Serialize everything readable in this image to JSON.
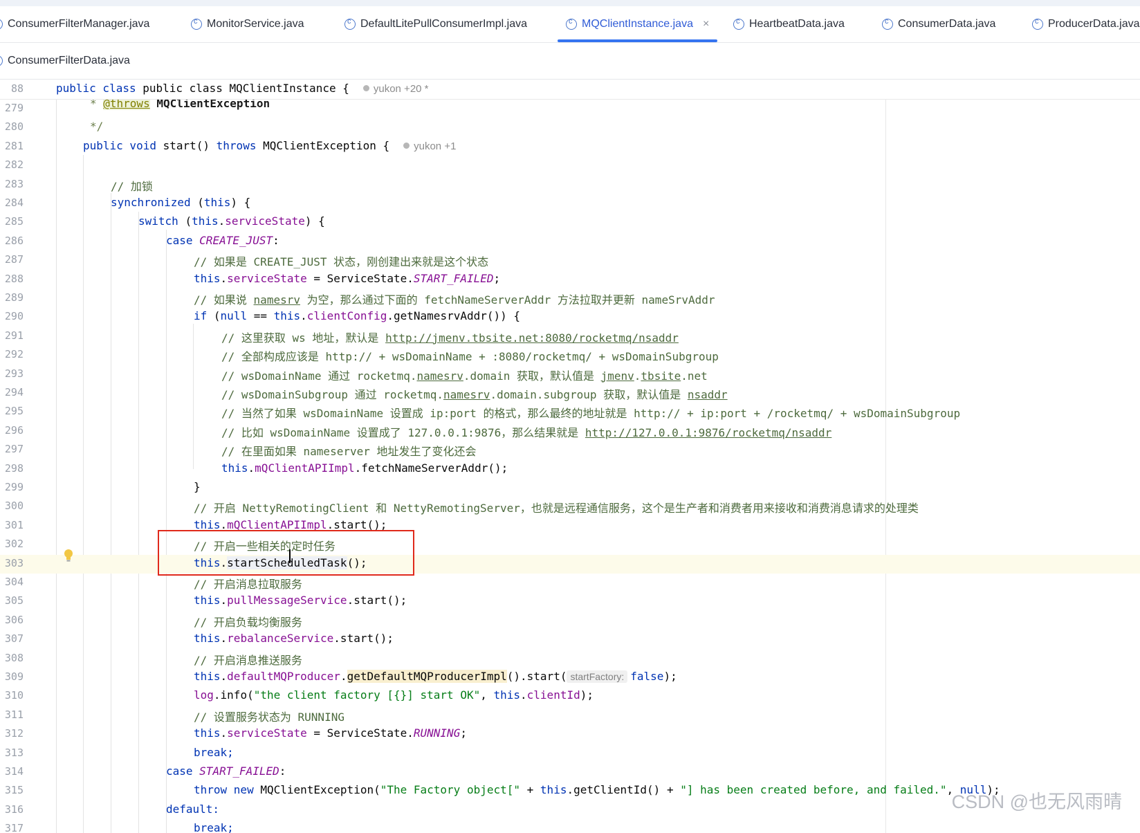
{
  "tabs": {
    "row1": [
      {
        "label": "ConsumerFilterManager.java"
      },
      {
        "label": "MonitorService.java"
      },
      {
        "label": "DefaultLitePullConsumerImpl.java"
      },
      {
        "label": "MQClientInstance.java",
        "close": "×"
      },
      {
        "label": "HeartbeatData.java"
      },
      {
        "label": "ConsumerData.java"
      },
      {
        "label": "ProducerData.java"
      }
    ],
    "row2": [
      {
        "label": "ConsumerFilterData.java"
      }
    ]
  },
  "sticky_header": {
    "line_number": "88",
    "code": "public class MQClientInstance {",
    "author": "yukon +20 *"
  },
  "method_author": "yukon +1",
  "inlay_hint": "startFactory:",
  "line_numbers": [
    "279",
    "280",
    "281",
    "282",
    "283",
    "284",
    "285",
    "286",
    "287",
    "288",
    "289",
    "290",
    "291",
    "292",
    "293",
    "294",
    "295",
    "296",
    "297",
    "298",
    "299",
    "300",
    "301",
    "302",
    "303",
    "304",
    "305",
    "306",
    "307",
    "308",
    "309",
    "310",
    "311",
    "312",
    "313",
    "314",
    "315",
    "316",
    "317"
  ],
  "code": {
    "l279": "@throws",
    "l279b": " MQClientException",
    "l281a": "public void ",
    "l281b": "start() ",
    "l281c": "throws ",
    "l281d": "MQClientException {",
    "l283": "// 加锁",
    "l284a": "synchronized ",
    "l284b": "(",
    "l284c": "this",
    "l284d": ") {",
    "l285a": "switch ",
    "l285b": "(",
    "l285c": "this",
    "l285d": ".",
    "l285e": "serviceState",
    "l285f": ") {",
    "l286a": "case ",
    "l286b": "CREATE_JUST",
    "l286c": ":",
    "l287": "// 如果是 CREATE_JUST 状态，刚创建出来就是这个状态",
    "l288a": "this",
    "l288b": ".",
    "l288c": "serviceState",
    "l288d": " = ServiceState.",
    "l288e": "START_FAILED",
    "l288f": ";",
    "l289a": "// 如果说 ",
    "l289b": "namesrv",
    "l289c": " 为空，那么通过下面的 fetchNameServerAddr 方法拉取并更新 nameSrvAddr",
    "l290a": "if ",
    "l290b": "(",
    "l290c": "null",
    "l290d": " == ",
    "l290e": "this",
    "l290f": ".",
    "l290g": "clientConfig",
    "l290h": ".getNamesrvAddr()) {",
    "l291a": "// 这里获取 ws 地址，默认是 ",
    "l291b": "http://jmenv.tbsite.net:8080/rocketmq/nsaddr",
    "l292": "// 全部构成应该是 http:// + wsDomainName + :8080/rocketmq/ + wsDomainSubgroup",
    "l293a": "// wsDomainName 通过 rocketmq.",
    "l293b": "namesrv",
    "l293c": ".domain 获取，默认值是 ",
    "l293d": "jmenv",
    "l293e": ".",
    "l293f": "tbsite",
    "l293g": ".net",
    "l294a": "// wsDomainSubgroup 通过 rocketmq.",
    "l294b": "namesrv",
    "l294c": ".domain.subgroup 获取，默认值是 ",
    "l294d": "nsaddr",
    "l295": "// 当然了如果 wsDomainName 设置成 ip:port 的格式，那么最终的地址就是 http:// + ip:port + /rocketmq/ + wsDomainSubgroup",
    "l296a": "// 比如 wsDomainName 设置成了 127.0.0.1:9876，那么结果就是 ",
    "l296b": "http://127.0.0.1:9876/rocketmq/nsaddr",
    "l297": "// 在里面如果 nameserver 地址发生了变化还会",
    "l298a": "this",
    "l298b": ".",
    "l298c": "mQClientAPIImpl",
    "l298d": ".fetchNameServerAddr();",
    "l299": "}",
    "l300": "// 开启 NettyRemotingClient 和 NettyRemotingServer，也就是远程通信服务，这个是生产者和消费者用来接收和消费消息请求的处理类",
    "l301a": "this",
    "l301b": ".",
    "l301c": "mQClientAPIImpl",
    "l301d": ".start();",
    "l302": "// 开启一些相关的定时任务",
    "l303a": "this",
    "l303b": ".",
    "l303c": "startScheduledTask",
    "l303d": "();",
    "l304": "// 开启消息拉取服务",
    "l305a": "this",
    "l305b": ".",
    "l305c": "pullMessageService",
    "l305d": ".start();",
    "l306": "// 开启负载均衡服务",
    "l307a": "this",
    "l307b": ".",
    "l307c": "rebalanceService",
    "l307d": ".start();",
    "l308": "// 开启消息推送服务",
    "l309a": "this",
    "l309b": ".",
    "l309c": "defaultMQProducer",
    "l309d": ".",
    "l309e": "getDefaultMQProducerImpl",
    "l309f": "().start(",
    "l309g": "false",
    "l309h": ");",
    "l310a": "log",
    "l310b": ".info(",
    "l310c": "\"the client factory [{}] start OK\"",
    "l310d": ", ",
    "l310e": "this",
    "l310f": ".",
    "l310g": "clientId",
    "l310h": ");",
    "l311": "// 设置服务状态为 RUNNING",
    "l312a": "this",
    "l312b": ".",
    "l312c": "serviceState",
    "l312d": " = ServiceState.",
    "l312e": "RUNNING",
    "l312f": ";",
    "l313": "break;",
    "l314a": "case ",
    "l314b": "START_FAILED",
    "l314c": ":",
    "l315a": "throw new ",
    "l315b": "MQClientException(",
    "l315c": "\"The Factory object[\"",
    "l315d": " + ",
    "l315e": "this",
    "l315f": ".getClientId() + ",
    "l315g": "\"] has been created before, and failed.\"",
    "l315h": ", ",
    "l315i": "null",
    "l315j": ");",
    "l316": "default:",
    "l317": "break;"
  },
  "watermark": "CSDN @也无风雨晴",
  "colors": {
    "keyword": "#0033b3",
    "field": "#871094",
    "string": "#067d17",
    "comment": "#4d6a3d",
    "highlight_box": "#e0291b",
    "active_tab_underline": "#3574f0"
  }
}
